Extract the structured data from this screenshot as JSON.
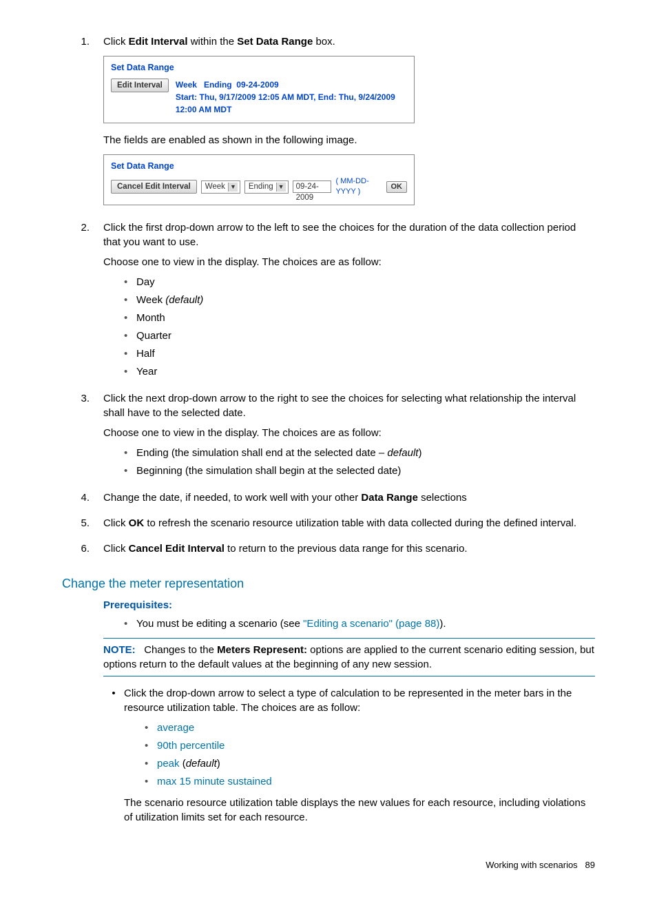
{
  "step1": {
    "num": "1.",
    "pre": "Click ",
    "bold1": "Edit Interval",
    "mid": " within the ",
    "bold2": "Set Data Range",
    "post": " box."
  },
  "sbox1": {
    "title": "Set Data Range",
    "btn": "Edit Interval",
    "line1": "Week   Ending  09-24-2009",
    "line2": "Start: Thu, 9/17/2009 12:05 AM MDT, End: Thu, 9/24/2009 12:00 AM MDT"
  },
  "after1": "The fields are enabled as shown in the following image.",
  "sbox2": {
    "title": "Set Data Range",
    "btn": "Cancel Edit Interval",
    "dd1": "Week",
    "dd2": "Ending",
    "date": "09-24-2009",
    "fmt": "( MM-DD-YYYY )",
    "ok": "OK"
  },
  "step2": {
    "num": "2.",
    "p1": "Click the first drop-down arrow to the left to see the choices for the duration of the data collection period that you want to use.",
    "p2": "Choose one to view in the display. The choices are as follow:",
    "choices": {
      "c1": "Day",
      "c2a": "Week ",
      "c2b": "(default)",
      "c3": "Month",
      "c4": "Quarter",
      "c5": "Half",
      "c6": "Year"
    }
  },
  "step3": {
    "num": "3.",
    "p1": "Click the next drop-down arrow to the right to see the choices for selecting what relationship the interval shall have to the selected date.",
    "p2": "Choose one to view in the display. The choices are as follow:",
    "b1a": "Ending (the simulation shall end at the selected date – ",
    "b1b": "default",
    "b1c": ")",
    "b2": "Beginning (the simulation shall begin at the selected date)"
  },
  "step4": {
    "num": "4.",
    "pre": "Change the date, if needed, to work well with your other ",
    "bold": "Data Range",
    "post": " selections"
  },
  "step5": {
    "num": "5.",
    "pre": "Click ",
    "bold": "OK",
    "post": " to refresh the scenario resource utilization table with data collected during the defined interval."
  },
  "step6": {
    "num": "6.",
    "pre": "Click ",
    "bold": "Cancel Edit Interval",
    "post": " to return to the previous data range for this scenario."
  },
  "section": "Change the meter representation",
  "prereq_label": "Prerequisites:",
  "prereq_item_pre": "You must be editing a scenario (see ",
  "prereq_link": "\"Editing a scenario\" (page 88)",
  "prereq_item_post": ").",
  "note": {
    "label": "NOTE:",
    "pre": "Changes to the ",
    "bold": "Meters Represent:",
    "post": " options are applied to the current scenario editing session, but options return to the default values at the beginning of any new session."
  },
  "sub": {
    "p1": "Click the drop-down arrow to select a type of calculation to be represented in the meter bars in the resource utilization table. The choices are as follow:",
    "c1": "average",
    "c2": "90th percentile",
    "c3a": "peak",
    "c3b": " (",
    "c3c": "default",
    "c3d": ")",
    "c4": "max 15 minute sustained",
    "p2": "The scenario resource utilization table displays the new values for each resource, including violations of utilization limits set for each resource."
  },
  "footer": {
    "text": "Working with scenarios",
    "page": "89"
  }
}
